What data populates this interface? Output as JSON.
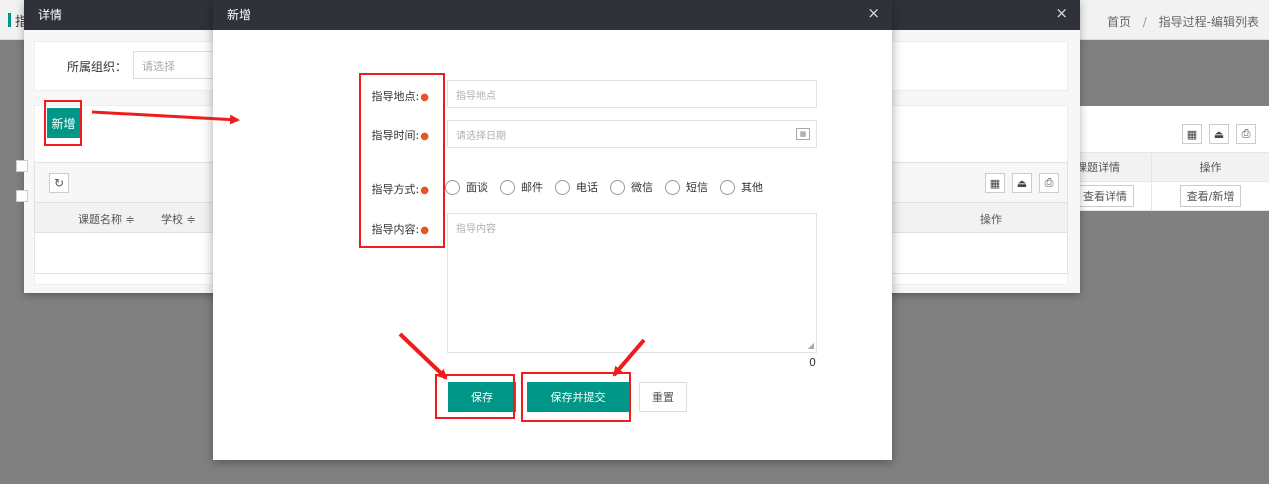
{
  "page": {
    "title_fragment": "指",
    "breadcrumb": {
      "home": "首页",
      "separator": "/",
      "current": "指导过程-编辑列表"
    },
    "side_table": {
      "header": [
        "课题详情",
        "操作"
      ],
      "row": [
        "查看详情",
        "查看/新增"
      ]
    }
  },
  "detail_modal": {
    "title": "详情",
    "close": "×",
    "filter": {
      "label": "所属组织：",
      "placeholder": "请选择"
    },
    "add_button": "新增",
    "table_headers": [
      "课题名称 ≑",
      "学校 ≑",
      "操作"
    ]
  },
  "new_modal": {
    "title": "新增",
    "close": "×",
    "fields": {
      "location": {
        "label": "指导地点:",
        "placeholder": "指导地点"
      },
      "time": {
        "label": "指导时间:",
        "placeholder": "请选择日期"
      },
      "method": {
        "label": "指导方式:",
        "options": [
          "面谈",
          "邮件",
          "电话",
          "微信",
          "短信",
          "其他"
        ]
      },
      "content": {
        "label": "指导内容:",
        "placeholder": "指导内容",
        "char_count": "0"
      }
    },
    "buttons": {
      "save": "保存",
      "save_submit": "保存并提交",
      "reset": "重置"
    }
  },
  "colors": {
    "primary": "#009688",
    "header": "#2f3238",
    "annotation": "#ee1c1c",
    "required": "#e8542a"
  }
}
